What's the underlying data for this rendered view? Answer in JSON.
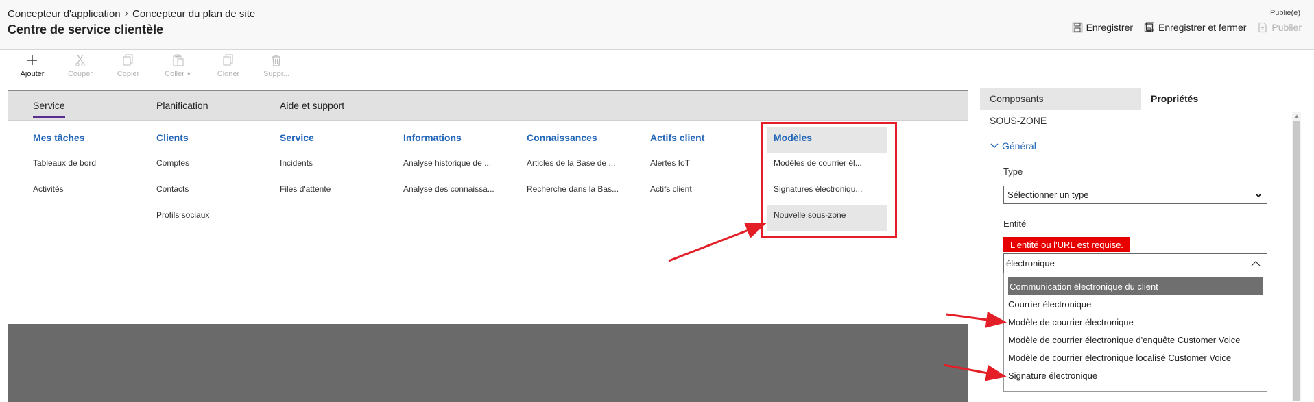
{
  "header": {
    "breadcrumb": [
      "Concepteur d'application",
      "Concepteur du plan de site"
    ],
    "title": "Centre de service clientèle",
    "status": "Publié(e)",
    "save_label": "Enregistrer",
    "save_close_label": "Enregistrer et fermer",
    "publish_label": "Publier"
  },
  "toolbar": {
    "add": "Ajouter",
    "cut": "Couper",
    "copy": "Copier",
    "paste": "Coller",
    "clone": "Cloner",
    "delete": "Suppr..."
  },
  "canvas": {
    "areas": [
      "Service",
      "Planification",
      "Aide et support"
    ],
    "groups": [
      {
        "title": "Mes tâches",
        "items": [
          "Tableaux de bord",
          "Activités"
        ]
      },
      {
        "title": "Clients",
        "items": [
          "Comptes",
          "Contacts",
          "Profils sociaux"
        ]
      },
      {
        "title": "Service",
        "items": [
          "Incidents",
          "Files d'attente"
        ]
      },
      {
        "title": "Informations",
        "items": [
          "Analyse historique de ...",
          "Analyse des connaissa..."
        ]
      },
      {
        "title": "Connaissances",
        "items": [
          "Articles de la Base de ...",
          "Recherche dans la Bas..."
        ]
      },
      {
        "title": "Actifs client",
        "items": [
          "Alertes IoT",
          "Actifs client"
        ]
      },
      {
        "title": "Modèles",
        "items": [
          "Modèles de courrier él...",
          "Signatures électroniqu...",
          "Nouvelle sous-zone"
        ]
      }
    ]
  },
  "panel": {
    "tabs": [
      "Composants",
      "Propriétés"
    ],
    "section": "SOUS-ZONE",
    "general": "Général",
    "type_label": "Type",
    "type_value": "Sélectionner un type",
    "entity_label": "Entité",
    "error": "L'entité ou l'URL est requise.",
    "entity_value": "électronique",
    "options": [
      "Communication électronique du client",
      "Courrier électronique",
      "Modèle de courrier électronique",
      "Modèle de courrier électronique d'enquête Customer Voice",
      "Modèle de courrier électronique localisé Customer Voice",
      "Signature électronique"
    ]
  },
  "colors": {
    "accent": "#5c2d91",
    "link": "#2266b8",
    "annotation": "#e41e26",
    "error": "#e60000"
  }
}
